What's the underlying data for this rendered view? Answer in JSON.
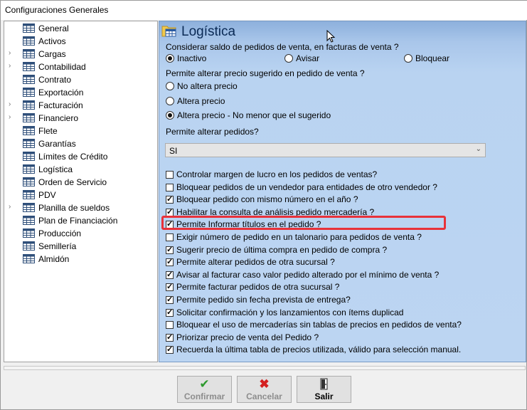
{
  "window": {
    "title": "Configuraciones Generales"
  },
  "tree": {
    "items": [
      {
        "label": "General",
        "expandable": false
      },
      {
        "label": "Activos",
        "expandable": false
      },
      {
        "label": "Cargas",
        "expandable": true
      },
      {
        "label": "Contabilidad",
        "expandable": true
      },
      {
        "label": "Contrato",
        "expandable": false
      },
      {
        "label": "Exportación",
        "expandable": false
      },
      {
        "label": "Facturación",
        "expandable": true
      },
      {
        "label": "Financiero",
        "expandable": true
      },
      {
        "label": "Flete",
        "expandable": false
      },
      {
        "label": "Garantías",
        "expandable": false
      },
      {
        "label": "Límites de Crédito",
        "expandable": false
      },
      {
        "label": "Logística",
        "expandable": false
      },
      {
        "label": "Orden de Servicio",
        "expandable": false
      },
      {
        "label": "PDV",
        "expandable": false
      },
      {
        "label": "Planilla de sueldos",
        "expandable": true
      },
      {
        "label": "Plan de Financiación",
        "expandable": false
      },
      {
        "label": "Producción",
        "expandable": false
      },
      {
        "label": "Semillería",
        "expandable": false
      },
      {
        "label": "Almidón",
        "expandable": false
      }
    ]
  },
  "panel": {
    "title": "Logística",
    "q1": {
      "label": "Considerar saldo de pedidos de venta, en facturas de venta ?",
      "options": [
        {
          "label": "Inactivo",
          "selected": true
        },
        {
          "label": "Avisar",
          "selected": false
        },
        {
          "label": "Bloquear",
          "selected": false
        }
      ]
    },
    "q2": {
      "label": "Permite alterar precio sugerido en pedido de venta ?",
      "options": [
        {
          "label": "No altera precio",
          "selected": false
        },
        {
          "label": "Altera precio",
          "selected": false
        },
        {
          "label": "Altera precio - No menor que el sugerido",
          "selected": true
        }
      ]
    },
    "q3": {
      "label": "Permite alterar pedidos?",
      "value": "SI"
    },
    "checks": [
      {
        "label": "Controlar margen de lucro en los pedidos de ventas?",
        "checked": false
      },
      {
        "label": "Bloquear pedidos de un vendedor para entidades de otro vendedor ?",
        "checked": false
      },
      {
        "label": "Bloquear pedido con mismo número en el año ?",
        "checked": true
      },
      {
        "label": "Habilitar la consulta de análisis pedido mercadería ?",
        "checked": true
      },
      {
        "label": "Permite Informar títulos en el pedido ?",
        "checked": true
      },
      {
        "label": "Exigir número de pedido en un talonario para pedidos de venta ?",
        "checked": false
      },
      {
        "label": "Sugerir precio de última compra en pedido de compra ?",
        "checked": true
      },
      {
        "label": "Permite alterar pedidos de otra sucursal ?",
        "checked": true
      },
      {
        "label": "Avisar al facturar caso valor pedido alterado por el mínimo de venta ?",
        "checked": true
      },
      {
        "label": "Permite facturar pedidos de otra sucursal ?",
        "checked": true
      },
      {
        "label": "Permite pedido sin fecha prevista de entrega?",
        "checked": true
      },
      {
        "label": "Solicitar confirmación y los lanzamientos con ítems duplicad",
        "checked": true
      },
      {
        "label": "Bloquear el uso de mercaderías sin tablas de precios en pedidos de venta?",
        "checked": false
      },
      {
        "label": "Priorizar precio de venta del Pedido ?",
        "checked": true
      },
      {
        "label": "Recuerda la última tabla de precios utilizada, válido para selección manual.",
        "checked": true
      }
    ]
  },
  "buttons": {
    "confirm": "Confirmar",
    "cancel": "Cancelar",
    "exit": "Salir"
  },
  "colors": {
    "highlight": "#e8323a",
    "confirm_icon": "#2e9a2e",
    "cancel_icon": "#d42020"
  }
}
